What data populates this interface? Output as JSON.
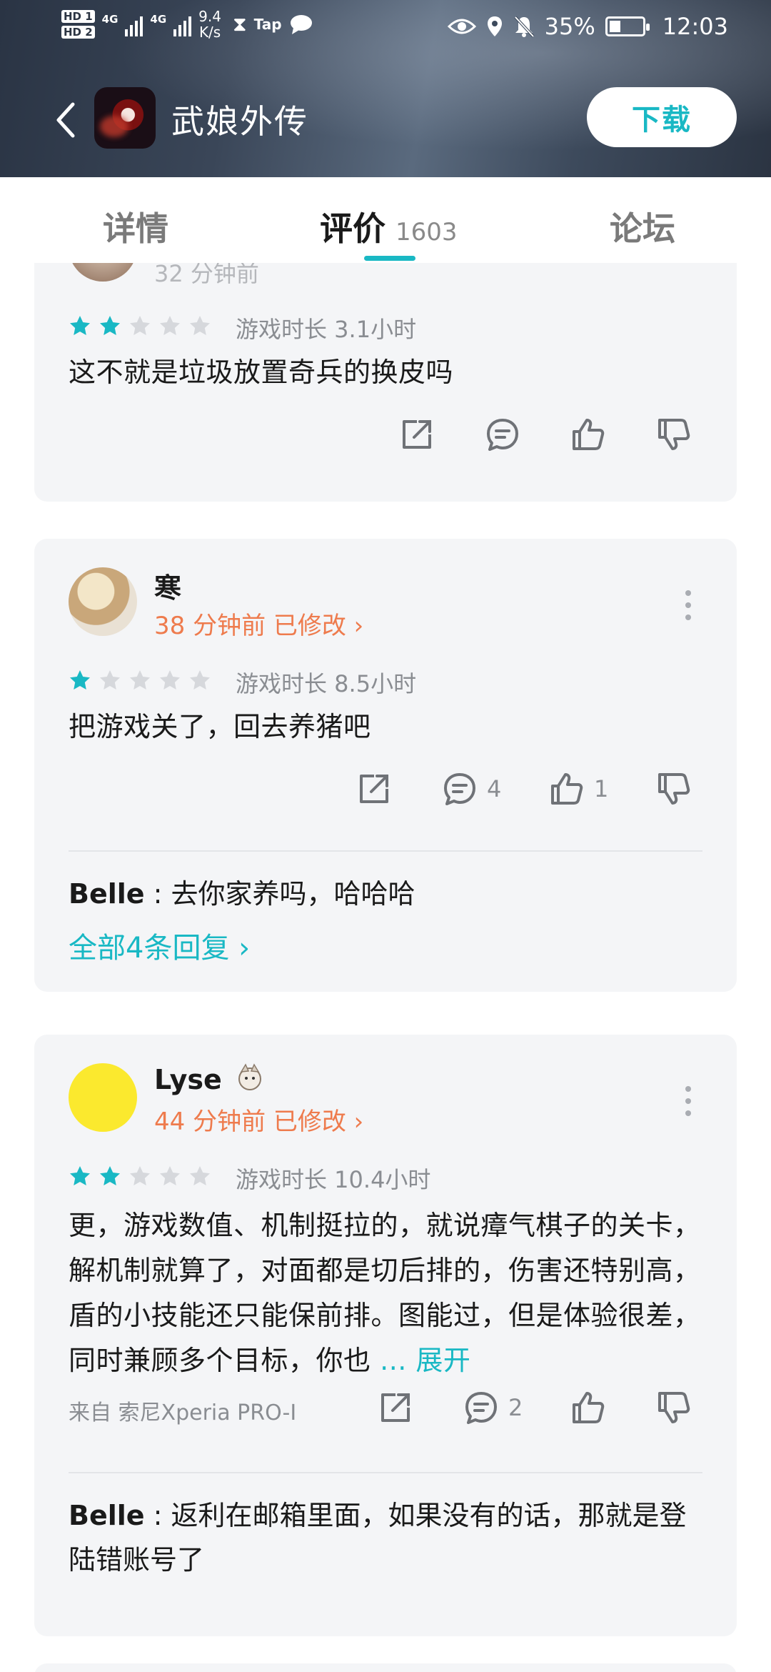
{
  "status_bar": {
    "sim1": "HD 1",
    "sim2": "HD 2",
    "net1": "4G",
    "net2": "4G",
    "speed_value": "9.4",
    "speed_unit": "K/s",
    "tap_label": "Tap",
    "battery": "35%",
    "battery_level": 0.35,
    "time": "12:03"
  },
  "app": {
    "title": "武娘外传",
    "download_label": "下载"
  },
  "tabs": [
    {
      "label": "详情"
    },
    {
      "label": "评价",
      "count": "1603"
    },
    {
      "label": "论坛"
    }
  ],
  "reviews": [
    {
      "time": "32 分钟前",
      "stars": 2,
      "playtime": "游戏时长 3.1小时",
      "text": "这不就是垃圾放置奇兵的换皮吗"
    },
    {
      "username": "寒",
      "meta": "38 分钟前 已修改 ›",
      "stars": 1,
      "playtime": "游戏时长 8.5小时",
      "text": "把游戏关了，回去养猪吧",
      "comments": "4",
      "likes": "1",
      "reply_user": "Belle",
      "reply_text": " : 去你家养吗，哈哈哈",
      "all_replies": "全部4条回复 ›"
    },
    {
      "username": "Lyse",
      "meta": "44 分钟前 已修改 ›",
      "stars": 2,
      "playtime": "游戏时长 10.4小时",
      "text": "更，游戏数值、机制挺拉的，就说瘴气棋子的关卡，解机制就算了，对面都是切后排的，伤害还特别高，盾的小技能还只能保前排。图能过，但是体验很差，同时兼顾多个目标，你也",
      "expand": "... 展开",
      "device": "来自 索尼Xperia PRO-I",
      "comments": "2",
      "reply_user": "Belle",
      "reply_text": " : 返利在邮箱里面，如果没有的话，那就是登陆错账号了"
    }
  ],
  "colors": {
    "accent": "#19b8c4",
    "meta_orange": "#ee7b4d",
    "star_empty": "#d6d8dc",
    "card_bg": "#f4f5f7"
  }
}
